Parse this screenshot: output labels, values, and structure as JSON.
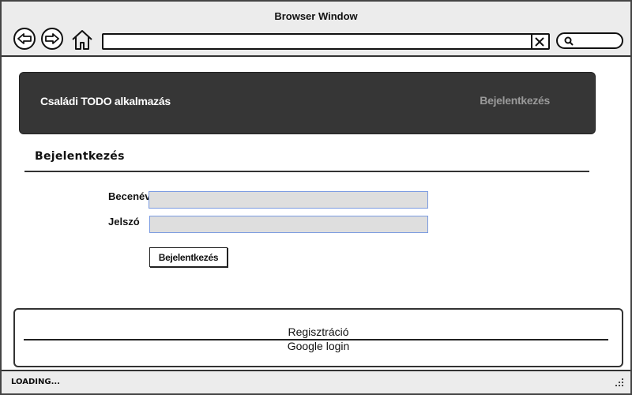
{
  "window": {
    "title": "Browser Window"
  },
  "toolbar": {
    "back_icon": "back-arrow-icon",
    "forward_icon": "forward-arrow-icon",
    "home_icon": "home-icon",
    "url_value": "",
    "clear_icon": "close-icon",
    "search_icon": "search-icon",
    "search_value": ""
  },
  "navbar": {
    "brand": "Családi TODO alkalmazás",
    "login_link": "Bejelentkezés",
    "background": "#363636",
    "login_color": "#9a9a9a"
  },
  "login_form": {
    "heading": "Bejelentkezés",
    "username_label": "Becenév",
    "username_value": "",
    "password_label": "Jelszó",
    "password_value": "",
    "submit_label": "Bejelentkezés"
  },
  "footer": {
    "register_link": "Regisztráció",
    "google_link": "Google login"
  },
  "status": {
    "text": "LOADING...",
    "grip_icon": "resize-grip-icon"
  }
}
